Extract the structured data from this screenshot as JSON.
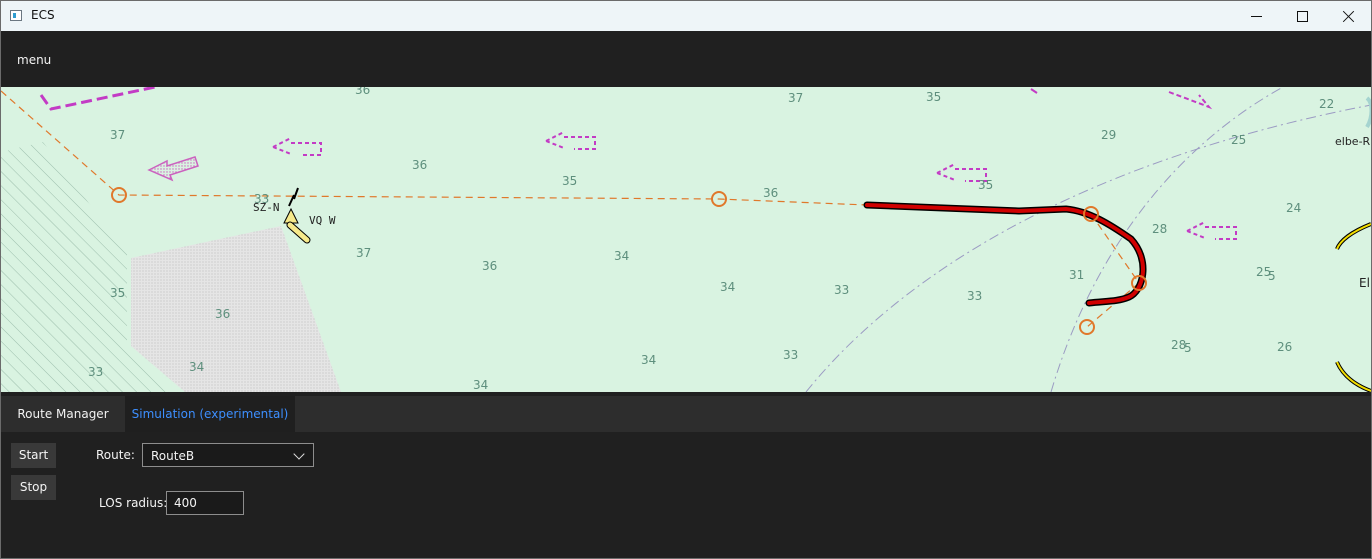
{
  "window": {
    "title": "ECS",
    "controls": [
      "minimize",
      "maximize",
      "close"
    ]
  },
  "menu": {
    "label": "menu"
  },
  "map": {
    "symbol_labels": {
      "sz": "SZ-N",
      "vq": "VQ W",
      "elbe": "elbe-R",
      "el": "El"
    },
    "depth_soundings": [
      "36",
      "37",
      "35",
      "22",
      "37",
      "29",
      "25",
      "36",
      "35",
      "36",
      "35",
      "33",
      "24",
      "28",
      "37",
      "36",
      "34",
      "31",
      "25",
      "5",
      "35",
      "34",
      "33",
      "33",
      "36",
      "34",
      "33",
      "28",
      "5",
      "26",
      "33",
      "34",
      "34"
    ],
    "colors": {
      "water": "#d9f3e1",
      "route": "#d00000",
      "waypoint": "#e0782b",
      "traffic": "#c33bc5"
    }
  },
  "tabs": [
    {
      "label": "Route Manager",
      "selected": false
    },
    {
      "label": "Simulation (experimental)",
      "selected": true
    }
  ],
  "simulation": {
    "start_label": "Start",
    "stop_label": "Stop",
    "route_label": "Route:",
    "route_value": "RouteB",
    "los_label": "LOS radius:",
    "los_value": "400"
  }
}
